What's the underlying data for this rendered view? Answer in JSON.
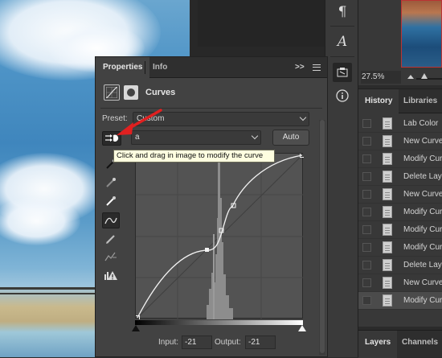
{
  "properties": {
    "tabs": [
      "Properties",
      "Info"
    ],
    "collapse_label": ">>",
    "adjustment_title": "Curves",
    "preset_label": "Preset:",
    "preset_value": "Custom",
    "channel_value": "a",
    "auto_label": "Auto",
    "input_label": "Input:",
    "input_value": "-21",
    "output_label": "Output:",
    "output_value": "-21",
    "tooltip": "Click and drag in image to modify the curve"
  },
  "navigator": {
    "zoom": "27.5%"
  },
  "history": {
    "tabs": [
      "History",
      "Libraries"
    ],
    "items": [
      {
        "label": "Lab Color",
        "selected": false
      },
      {
        "label": "New Curves",
        "selected": false
      },
      {
        "label": "Modify Curves",
        "selected": false
      },
      {
        "label": "Delete Layer",
        "selected": false
      },
      {
        "label": "New Curves",
        "selected": false
      },
      {
        "label": "Modify Curves",
        "selected": false
      },
      {
        "label": "Modify Curves",
        "selected": false
      },
      {
        "label": "Modify Curves",
        "selected": false
      },
      {
        "label": "Delete Layer",
        "selected": false
      },
      {
        "label": "New Curves",
        "selected": false
      },
      {
        "label": "Modify Curves",
        "selected": true
      }
    ]
  },
  "layers_panel": {
    "tabs": [
      "Layers",
      "Channels"
    ]
  },
  "tool_icons": {
    "right_column": [
      "paragraph-icon",
      "character-icon",
      "adjustments-icon",
      "info-icon"
    ],
    "curves_tools": [
      "on-image-adjust-icon",
      "black-point-eyedropper-icon",
      "gray-point-eyedropper-icon",
      "white-point-eyedropper-icon",
      "curve-points-icon",
      "pencil-icon",
      "smooth-curve-icon",
      "clipping-warning-icon"
    ]
  },
  "colors": {
    "panel_bg": "#424242",
    "dark_bg": "#2b2b2b",
    "arrow": "#e02020",
    "tooltip_bg": "#fefee0"
  }
}
